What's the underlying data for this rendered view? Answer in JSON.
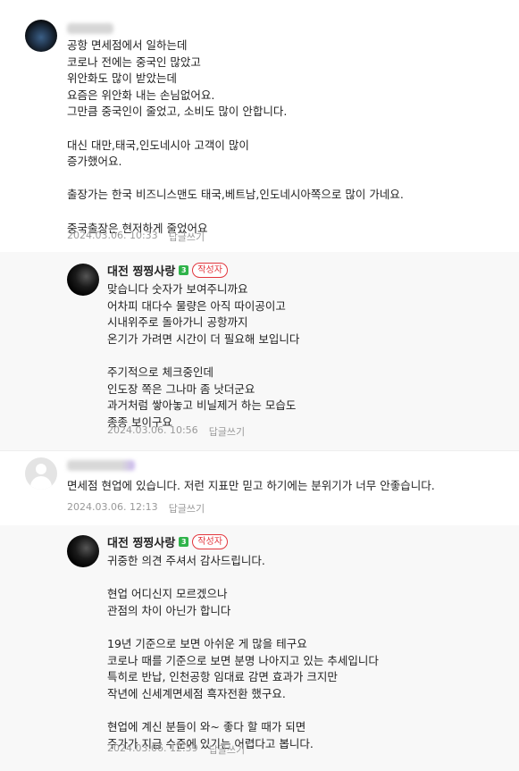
{
  "comments": [
    {
      "nickname": "",
      "lines": [
        "공항 면세점에서 일하는데",
        "코로나 전에는 중국인 많았고",
        "위안화도 많이 받았는데",
        "요즘은 위안화 내는 손님없어요.",
        "그만큼 중국인이 줄었고, 소비도 많이 안합니다.",
        "",
        "대신 대만,태국,인도네시아 고객이 많이",
        "증가했어요.",
        "",
        "출장가는 한국 비즈니스맨도 태국,베트남,인도네시아쪽으로 많이 가네요.",
        "",
        "중국출장은 현저하게 줄었어요"
      ],
      "date": "2024.03.06. 10:33",
      "reply_label": "답글쓰기"
    },
    {
      "nickname": "대전 찡찡사랑",
      "level": "3",
      "badge": "작성자",
      "lines": [
        "맞습니다 숫자가 보여주니까요",
        "어차피 대다수 물량은 아직 따이공이고",
        "시내위주로 돌아가니 공항까지",
        "온기가 가려면 시간이 더 필요해 보입니다",
        "",
        "주기적으로 체크중인데",
        "인도장 쪽은 그나마 좀 낫더군요",
        "과거처럼 쌓아놓고 비닐제거 하는 모습도",
        "종종 보이구요"
      ],
      "date": "2024.03.06. 10:56",
      "reply_label": "답글쓰기"
    },
    {
      "nickname": "",
      "lines": [
        "면세점 현업에 있습니다. 저런 지표만 믿고 하기에는 분위기가 너무 안좋습니다."
      ],
      "date": "2024.03.06. 12:13",
      "reply_label": "답글쓰기"
    },
    {
      "nickname": "대전 찡찡사랑",
      "level": "3",
      "badge": "작성자",
      "lines": [
        "귀중한 의견 주셔서 감사드립니다.",
        "",
        "현업 어디신지 모르겠으나",
        "관점의 차이 아닌가 합니다",
        "",
        "19년 기준으로 보면 아쉬운 게 많을 테구요",
        "코로나 때를 기준으로 보면 분명 나아지고 있는 추세입니다",
        "특히로 반납, 인천공항 임대료 감면 효과가 크지만",
        "작년에 신세계면세점 흑자전환 했구요.",
        "",
        "현업에 계신 분들이 와~ 좋다 할 때가 되면",
        "주가가 지금 수준에 있기는 어렵다고 봅니다."
      ],
      "date": "2024.03.06. 12:59",
      "reply_label": "답글쓰기"
    }
  ]
}
